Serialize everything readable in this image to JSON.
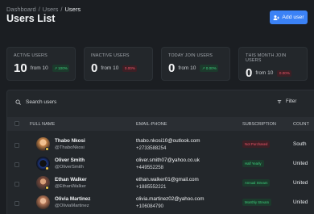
{
  "breadcrumb": [
    "Dashboard",
    "Users",
    "Users"
  ],
  "page_title": "Users List",
  "add_button": "Add user",
  "cards": [
    {
      "label": "ACTIVE USERS",
      "value": "10",
      "from": "from 10",
      "badge": "100%",
      "trend": "up"
    },
    {
      "label": "INACTIVE USERS",
      "value": "0",
      "from": "from 10",
      "badge": "0.00%",
      "trend": "down"
    },
    {
      "label": "TODAY JOIN USERS",
      "value": "0",
      "from": "from 10",
      "badge": "0.00%",
      "trend": "up"
    },
    {
      "label": "THIS MONTH JOIN USERS",
      "value": "0",
      "from": "from 10",
      "badge": "0.00%",
      "trend": "down"
    }
  ],
  "search": {
    "placeholder": "Search users"
  },
  "filter_label": "Filter",
  "table": {
    "headers": [
      "FULL NAME",
      "EMAIL-PHONE",
      "SUBSCRIPTION",
      "COUNT"
    ],
    "rows": [
      {
        "name": "Thabo Nkosi",
        "handle": "@ThaboNkosi",
        "email": "thabo.nkosi10@outlook.com",
        "phone": "+2733588254",
        "subscription": "Not Purchased",
        "sub_color": "red",
        "country": "South",
        "avatar_color": "#c9874a",
        "online": true
      },
      {
        "name": "Oliver Smith",
        "handle": "@OliverSmith",
        "email": "oliver.smith07@yahoo.co.uk",
        "phone": "+449552258",
        "subscription": "Half Yearly",
        "sub_color": "green",
        "country": "United",
        "avatar_color": "#1e3a8a",
        "online": true
      },
      {
        "name": "Ethan Walker",
        "handle": "@EthanWalker",
        "email": "ethan.walker01@gmail.com",
        "phone": "+1885552221",
        "subscription": "Annual Stream",
        "sub_color": "green",
        "country": "United",
        "avatar_color": "#7a4a3a",
        "online": true
      },
      {
        "name": "Olivia Martinez",
        "handle": "@OliviaMartinez",
        "email": "olivia.martinez02@yahoo.com",
        "phone": "+106084790",
        "subscription": "Monthly Stream",
        "sub_color": "green",
        "country": "United",
        "avatar_color": "#b87a5a",
        "online": false
      }
    ]
  }
}
